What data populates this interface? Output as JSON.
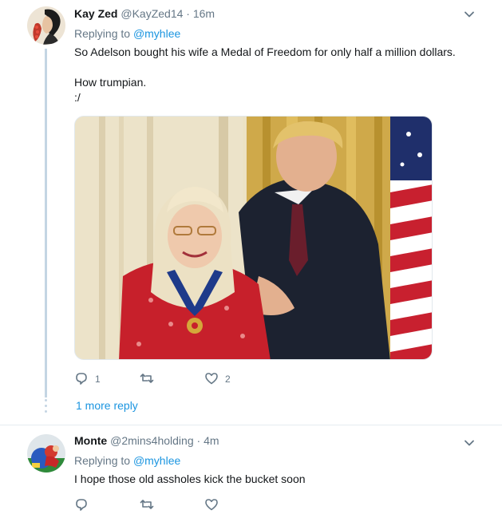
{
  "tweets": [
    {
      "name": "Kay Zed",
      "handle": "@KayZed14",
      "separator": "·",
      "time": "16m",
      "replying_prefix": "Replying to",
      "replying_to": "@myhlee",
      "text_lines": [
        "So Adelson bought his wife a Medal of Freedom for only half a million dollars.",
        "",
        "How trumpian.",
        ":/"
      ],
      "actions": {
        "reply_count": "1",
        "retweet_count": "",
        "like_count": "2"
      },
      "more_replies": "1 more reply"
    },
    {
      "name": "Monte",
      "handle": "@2mins4holding",
      "separator": "·",
      "time": "4m",
      "replying_prefix": "Replying to",
      "replying_to": "@myhlee",
      "text_lines": [
        "I hope those old assholes kick the bucket soon"
      ],
      "actions": {
        "reply_count": "",
        "retweet_count": "",
        "like_count": ""
      }
    }
  ],
  "colors": {
    "link": "#1b95e0",
    "secondary": "#657786",
    "thread_line": "#c4d5e3"
  },
  "icons": [
    "caret-down-icon",
    "reply-icon",
    "retweet-icon",
    "like-icon"
  ]
}
